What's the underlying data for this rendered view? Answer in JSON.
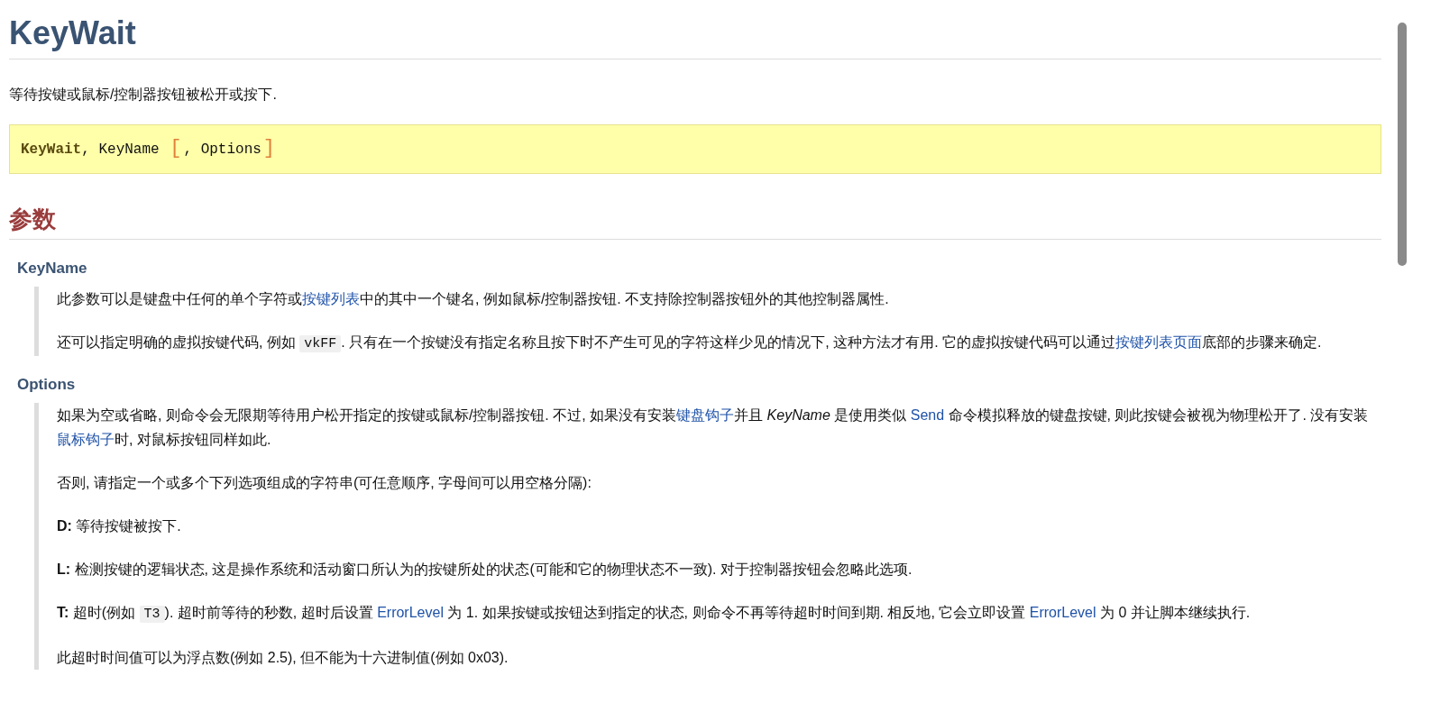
{
  "title": "KeyWait",
  "description": "等待按键或鼠标/控制器按钮被松开或按下.",
  "syntax": [
    {
      "kind": "command",
      "text": "KeyWait"
    },
    {
      "kind": "plain",
      "text": ", KeyName "
    },
    {
      "kind": "bracket",
      "text": "["
    },
    {
      "kind": "plain",
      "text": ", Options"
    },
    {
      "kind": "bracket",
      "text": "]"
    }
  ],
  "section": {
    "heading": "参数",
    "params": [
      {
        "name": "KeyName",
        "paragraphs": [
          [
            {
              "kind": "text",
              "text": "此参数可以是键盘中任何的单个字符或"
            },
            {
              "kind": "link",
              "text": "按键列表"
            },
            {
              "kind": "text",
              "text": "中的其中一个键名, 例如鼠标/控制器按钮. 不支持除控制器按钮外的其他控制器属性."
            }
          ],
          [
            {
              "kind": "text",
              "text": "还可以指定明确的虚拟按键代码, 例如 "
            },
            {
              "kind": "code",
              "text": "vkFF"
            },
            {
              "kind": "text",
              "text": ". 只有在一个按键没有指定名称且按下时不产生可见的字符这样少见的情况下, 这种方法才有用. 它的虚拟按键代码可以通过"
            },
            {
              "kind": "link",
              "text": "按键列表页面"
            },
            {
              "kind": "text",
              "text": "底部的步骤来确定."
            }
          ]
        ]
      },
      {
        "name": "Options",
        "paragraphs": [
          [
            {
              "kind": "text",
              "text": "如果为空或省略, 则命令会无限期等待用户松开指定的按键或鼠标/控制器按钮. 不过, 如果没有安装"
            },
            {
              "kind": "link",
              "text": "键盘钩子"
            },
            {
              "kind": "text",
              "text": "并且 "
            },
            {
              "kind": "italic",
              "text": "KeyName"
            },
            {
              "kind": "text",
              "text": " 是使用类似 "
            },
            {
              "kind": "link",
              "text": "Send"
            },
            {
              "kind": "text",
              "text": " 命令模拟释放的键盘按键, 则此按键会被视为物理松开了. 没有安装"
            },
            {
              "kind": "link",
              "text": "鼠标钩子"
            },
            {
              "kind": "text",
              "text": "时, 对鼠标按钮同样如此."
            }
          ],
          [
            {
              "kind": "text",
              "text": "否则, 请指定一个或多个下列选项组成的字符串(可任意顺序, 字母间可以用空格分隔):"
            }
          ],
          [
            {
              "kind": "bold",
              "text": "D:"
            },
            {
              "kind": "text",
              "text": " 等待按键被按下."
            }
          ],
          [
            {
              "kind": "bold",
              "text": "L:"
            },
            {
              "kind": "text",
              "text": " 检测按键的逻辑状态, 这是操作系统和活动窗口所认为的按键所处的状态(可能和它的物理状态不一致). 对于控制器按钮会忽略此选项."
            }
          ],
          [
            {
              "kind": "bold",
              "text": "T:"
            },
            {
              "kind": "text",
              "text": " 超时(例如 "
            },
            {
              "kind": "code",
              "text": "T3"
            },
            {
              "kind": "text",
              "text": "). 超时前等待的秒数, 超时后设置 "
            },
            {
              "kind": "link",
              "text": "ErrorLevel"
            },
            {
              "kind": "text",
              "text": " 为 1. 如果按键或按钮达到指定的状态, 则命令不再等待超时时间到期. 相反地, 它会立即设置 "
            },
            {
              "kind": "link",
              "text": "ErrorLevel"
            },
            {
              "kind": "text",
              "text": " 为 0 并让脚本继续执行."
            }
          ],
          [
            {
              "kind": "text",
              "text": "此超时时间值可以为浮点数(例如 2.5), 但不能为十六进制值(例如 0x03)."
            }
          ]
        ]
      }
    ]
  }
}
